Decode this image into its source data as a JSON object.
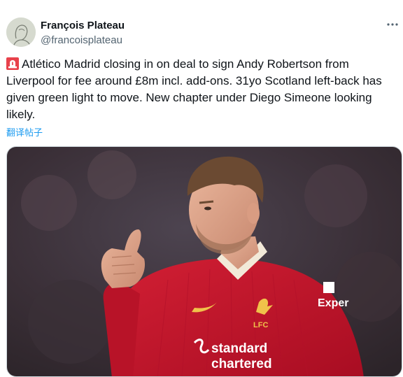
{
  "author": {
    "display_name": "François Plateau",
    "handle": "@francoisplateau",
    "avatar_icon": "profile-sketch-avatar"
  },
  "menu": {
    "icon": "more-horizontal-icon"
  },
  "tweet": {
    "emoji": "rotating-light-icon",
    "text": "Atlético Madrid closing in on deal to sign Andy Robertson from Liverpool for fee around £8m incl. add-ons. 31yo Scotland left-back has given green light to move. New chapter under Diego Simeone looking likely.",
    "translate_link": "翻译帖子"
  },
  "media": {
    "jersey_logo_text": "LFC",
    "sponsor_text_line1": "standard",
    "sponsor_text_line2": "chartered",
    "kit_sponsor_text": "Exper",
    "colors": {
      "jersey": "#c8102e",
      "background": "#3a2e35",
      "link": "#1d9bf0"
    }
  }
}
